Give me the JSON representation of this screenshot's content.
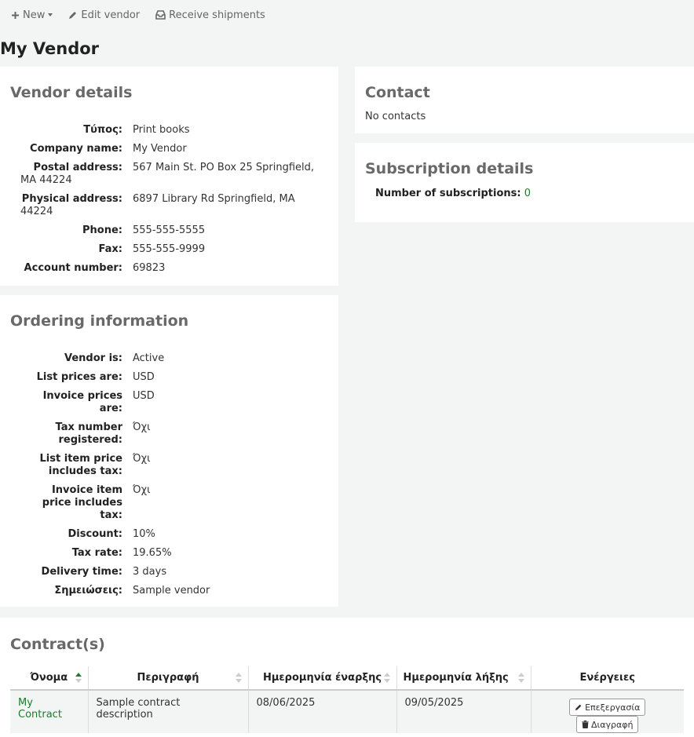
{
  "toolbar": {
    "new_label": "New",
    "edit_label": "Edit vendor",
    "receive_label": "Receive shipments"
  },
  "page_title": "My Vendor",
  "vendor_details": {
    "heading": "Vendor details",
    "type_label": "Τύπος:",
    "type_value": "Print books",
    "company_label": "Company name:",
    "company_value": "My Vendor",
    "postal_label": "Postal address:",
    "postal_value": "567 Main St. PO Box 25 Springfield, MA 44224",
    "physical_label": "Physical address:",
    "physical_value": "6897 Library Rd Springfield, MA 44224",
    "phone_label": "Phone:",
    "phone_value": "555-555-5555",
    "fax_label": "Fax:",
    "fax_value": "555-555-9999",
    "account_label": "Account number:",
    "account_value": "69823"
  },
  "contact": {
    "heading": "Contact",
    "empty_text": "No contacts"
  },
  "subscriptions": {
    "heading": "Subscription details",
    "count_label": "Number of subscriptions:",
    "count_value": "0"
  },
  "ordering": {
    "heading": "Ordering information",
    "active_label": "Vendor is:",
    "active_value": "Active",
    "list_prices_label": "List prices are:",
    "list_prices_value": "USD",
    "invoice_prices_label": "Invoice prices are:",
    "invoice_prices_value": "USD",
    "tax_reg_label": "Tax number registered:",
    "tax_reg_value": "Όχι",
    "list_tax_label": "List item price includes tax:",
    "list_tax_value": "Όχι",
    "invoice_tax_label": "Invoice item price includes tax:",
    "invoice_tax_value": "Όχι",
    "discount_label": "Discount:",
    "discount_value": "10%",
    "tax_rate_label": "Tax rate:",
    "tax_rate_value": "19.65%",
    "delivery_label": "Delivery time:",
    "delivery_value": "3 days",
    "notes_label": "Σημειώσεις:",
    "notes_value": "Sample vendor"
  },
  "contracts": {
    "heading": "Contract(s)",
    "columns": [
      "Όνομα",
      "Περιγραφή",
      "Ημερομηνία έναρξης",
      "Ημερομηνία λήξης",
      "Ενέργειες"
    ],
    "rows": [
      {
        "name": "My Contract",
        "description": "Sample contract description",
        "start": "08/06/2025",
        "end": "09/05/2025",
        "edit_label": "Επεξεργασία",
        "delete_label": "Διαγραφή"
      }
    ]
  },
  "colors": {
    "link": "#1c7d2c",
    "heading": "#696969",
    "background": "#f3f4f4"
  }
}
